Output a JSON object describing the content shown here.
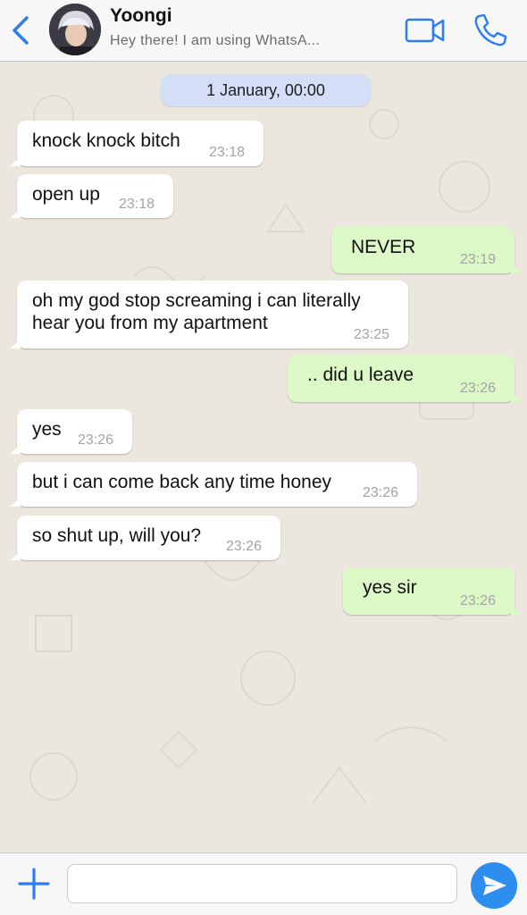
{
  "header": {
    "contact_name": "Yoongi",
    "contact_status": "Hey there! I am using WhatsA...",
    "accent_color": "#2d7cf6"
  },
  "chat": {
    "date_separator": "1 January, 00:00",
    "messages": [
      {
        "direction": "in",
        "text": "knock knock bitch",
        "time": "23:18"
      },
      {
        "direction": "in",
        "text": "open up",
        "time": "23:18"
      },
      {
        "direction": "out",
        "text": "NEVER",
        "time": "23:19"
      },
      {
        "direction": "in",
        "text_line1": "oh my god stop screaming i can literally",
        "text_line2": "hear you from my apartment",
        "time": "23:25"
      },
      {
        "direction": "out",
        "text": ".. did u leave",
        "time": "23:26"
      },
      {
        "direction": "in",
        "text": "yes",
        "time": "23:26"
      },
      {
        "direction": "in",
        "text": "but i can come back any time honey",
        "time": "23:26"
      },
      {
        "direction": "in",
        "text": "so shut up, will you?",
        "time": "23:26"
      },
      {
        "direction": "out",
        "text": "yes sir",
        "time": "23:26"
      }
    ],
    "incoming_bubble_color": "#ffffff",
    "outgoing_bubble_color": "#dcf8c6"
  },
  "composer": {
    "input_value": "",
    "icons": [
      "plus-icon",
      "send-icon"
    ]
  }
}
